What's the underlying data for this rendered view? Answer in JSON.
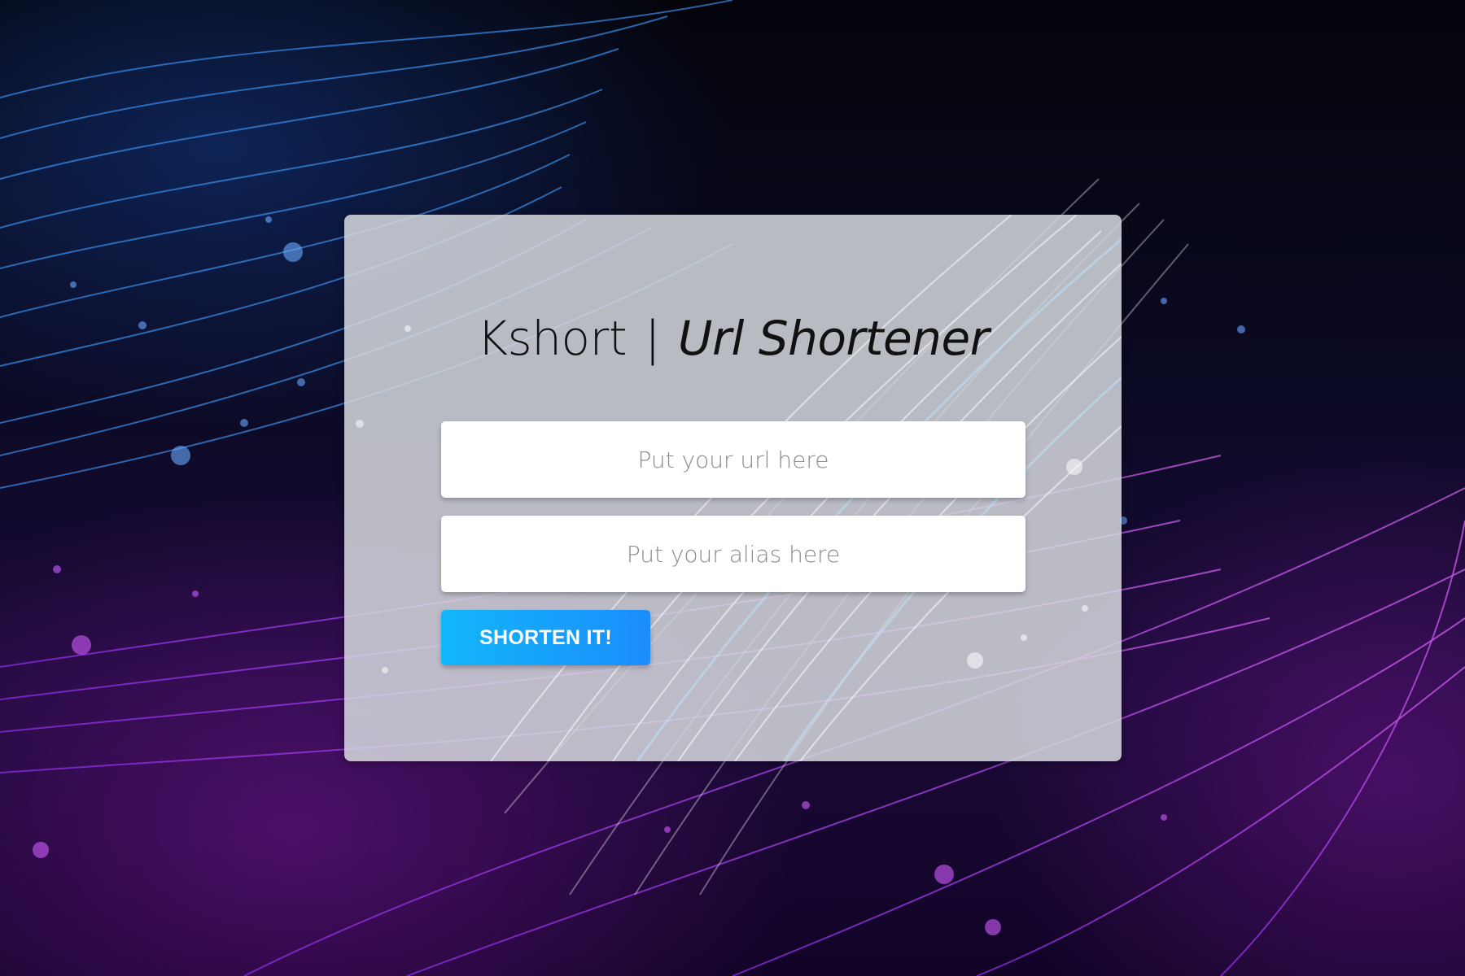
{
  "page": {
    "background_colors": {
      "top": "#04040b",
      "middle": "#0b0a24",
      "bottom": "#120427",
      "blue_streak": "#2f7bff",
      "purple_streak": "#c84bff"
    }
  },
  "card": {
    "title_brand": "Kshort",
    "title_separator": "|",
    "title_tagline": "Url Shortener",
    "url_input": {
      "value": "",
      "placeholder": "Put your url here"
    },
    "alias_input": {
      "value": "",
      "placeholder": "Put your alias here"
    },
    "submit_label": "SHORTEN IT!",
    "accent_color": "#13b6fb"
  }
}
